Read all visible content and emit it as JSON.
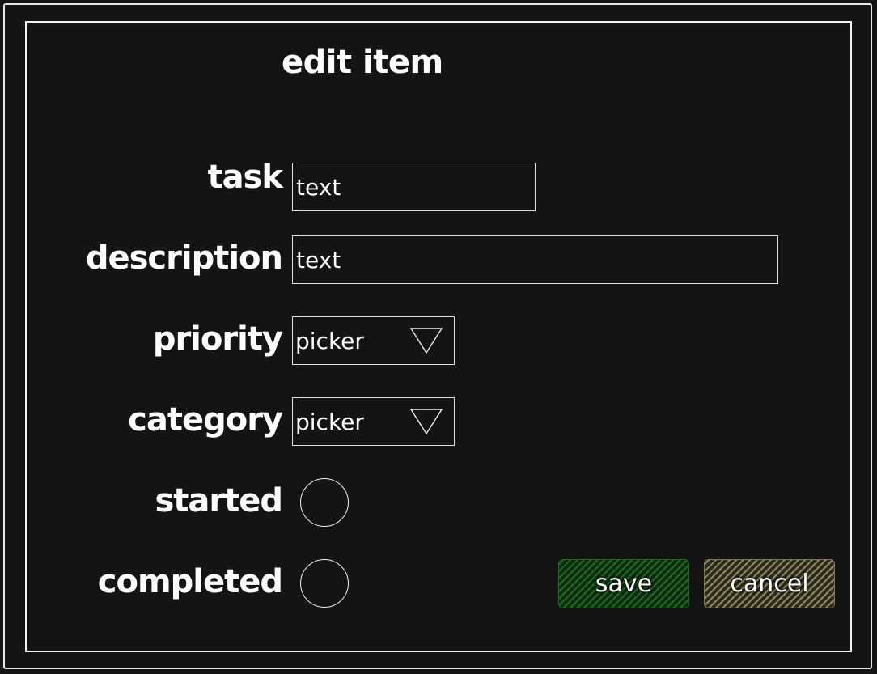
{
  "dialog": {
    "title": "edit item"
  },
  "form": {
    "task": {
      "label": "task",
      "value": "text"
    },
    "description": {
      "label": "description",
      "value": "text"
    },
    "priority": {
      "label": "priority",
      "value": "picker"
    },
    "category": {
      "label": "category",
      "value": "picker"
    },
    "started": {
      "label": "started"
    },
    "completed": {
      "label": "completed"
    }
  },
  "buttons": {
    "save_label": "save",
    "cancel_label": "cancel"
  },
  "colors": {
    "background": "#141414",
    "foreground": "#ffffff",
    "save_fill": "#1f6b22",
    "cancel_fill": "#8d8a5c"
  },
  "icons": {
    "picker_arrow": "triangle-down-icon"
  }
}
